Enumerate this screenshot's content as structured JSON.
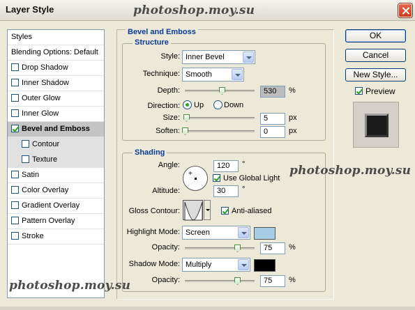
{
  "window": {
    "title": "Layer Style",
    "watermark": "photoshop.moy.su"
  },
  "styles_panel": {
    "items": [
      {
        "label": "Styles",
        "checkbox": false,
        "sub": false
      },
      {
        "label": "Blending Options: Default",
        "checkbox": false,
        "sub": false
      },
      {
        "label": "Drop Shadow",
        "checkbox": true,
        "checked": false,
        "sub": false
      },
      {
        "label": "Inner Shadow",
        "checkbox": true,
        "checked": false,
        "sub": false
      },
      {
        "label": "Outer Glow",
        "checkbox": true,
        "checked": false,
        "sub": false
      },
      {
        "label": "Inner Glow",
        "checkbox": true,
        "checked": false,
        "sub": false
      },
      {
        "label": "Bevel and Emboss",
        "checkbox": true,
        "checked": true,
        "sub": false,
        "selected": true
      },
      {
        "label": "Contour",
        "checkbox": true,
        "checked": false,
        "sub": true
      },
      {
        "label": "Texture",
        "checkbox": true,
        "checked": false,
        "sub": true
      },
      {
        "label": "Satin",
        "checkbox": true,
        "checked": false,
        "sub": false
      },
      {
        "label": "Color Overlay",
        "checkbox": true,
        "checked": false,
        "sub": false
      },
      {
        "label": "Gradient Overlay",
        "checkbox": true,
        "checked": false,
        "sub": false
      },
      {
        "label": "Pattern Overlay",
        "checkbox": true,
        "checked": false,
        "sub": false
      },
      {
        "label": "Stroke",
        "checkbox": true,
        "checked": false,
        "sub": false
      }
    ]
  },
  "bevel": {
    "section_title": "Bevel and Emboss",
    "structure": {
      "title": "Structure",
      "style_label": "Style:",
      "style_value": "Inner Bevel",
      "technique_label": "Technique:",
      "technique_value": "Smooth",
      "depth_label": "Depth:",
      "depth_value": "530",
      "depth_unit": "%",
      "depth_level": 0.53,
      "direction_label": "Direction:",
      "dir_up": "Up",
      "dir_down": "Down",
      "direction_selected": "Up",
      "size_label": "Size:",
      "size_value": "5",
      "size_unit": "px",
      "size_level": 0.02,
      "soften_label": "Soften:",
      "soften_value": "0",
      "soften_unit": "px",
      "soften_level": 0.0
    },
    "shading": {
      "title": "Shading",
      "angle_label": "Angle:",
      "angle_value": "120",
      "angle_unit": "°",
      "use_global_light_label": "Use Global Light",
      "use_global_light": true,
      "altitude_label": "Altitude:",
      "altitude_value": "30",
      "altitude_unit": "°",
      "gloss_contour_label": "Gloss Contour:",
      "anti_aliased_label": "Anti-aliased",
      "anti_aliased": true,
      "highlight_mode_label": "Highlight Mode:",
      "highlight_mode_value": "Screen",
      "highlight_color": "#a6cde4",
      "highlight_opacity_label": "Opacity:",
      "highlight_opacity_value": "75",
      "highlight_opacity_unit": "%",
      "highlight_opacity_level": 0.75,
      "shadow_mode_label": "Shadow Mode:",
      "shadow_mode_value": "Multiply",
      "shadow_color": "#000000",
      "shadow_opacity_label": "Opacity:",
      "shadow_opacity_value": "75",
      "shadow_opacity_unit": "%",
      "shadow_opacity_level": 0.75
    }
  },
  "buttons": {
    "ok": "OK",
    "cancel": "Cancel",
    "new_style": "New Style...",
    "preview_label": "Preview",
    "preview_checked": true
  }
}
